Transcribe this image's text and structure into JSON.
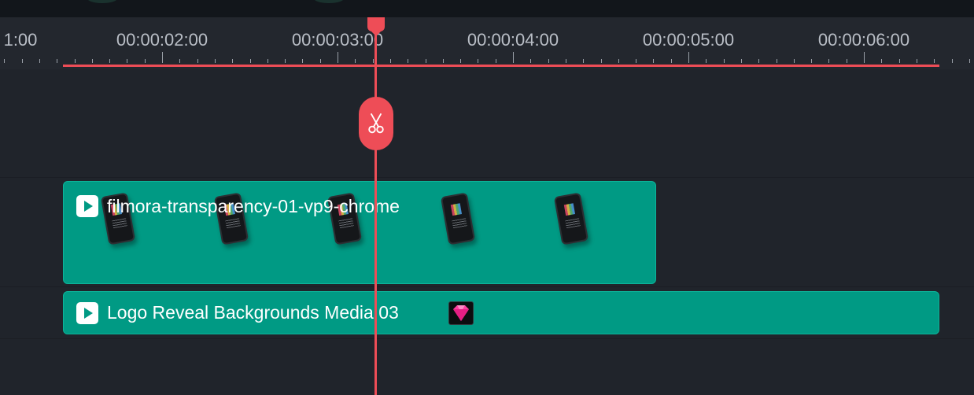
{
  "ruler": {
    "labels": [
      "1:00",
      "00:00:02:00",
      "00:00:03:00",
      "00:00:04:00",
      "00:00:05:00",
      "00:00:06:00"
    ]
  },
  "tracks": {
    "clip1": {
      "title": "filmora-transparency-01-vp9-chrome",
      "type_icon": "play-icon",
      "thumbnail_icon": "phone-thumbnail-icon"
    },
    "clip2": {
      "title": "Logo Reveal Backgrounds Media 03",
      "type_icon": "play-icon",
      "badge_icon": "premium-gem-icon"
    }
  },
  "playhead": {
    "time": "00:00:03:00",
    "cut_icon": "scissors-icon"
  },
  "colors": {
    "clip": "#009a84",
    "playhead": "#ee4d57",
    "background": "#20242b",
    "ruler_text": "#b9bec6"
  }
}
